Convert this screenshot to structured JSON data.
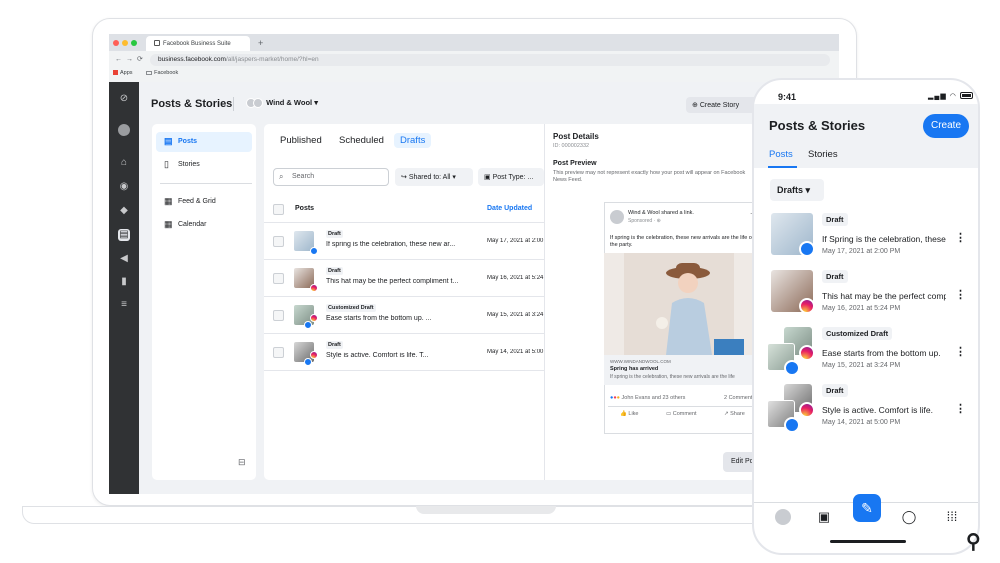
{
  "browser": {
    "tab_title": "Facebook Business Suite",
    "new_tab": "+",
    "url_host": "business.facebook.com",
    "url_path": "/all/jaspers-market/home/?hl=en",
    "bookmarks": [
      "Apps",
      "Facebook"
    ]
  },
  "desktop": {
    "page_title": "Posts & Stories",
    "account_name": "Wind & Wool",
    "create_story": "Create Story",
    "subnav": [
      {
        "label": "Posts",
        "icon": "posts-icon"
      },
      {
        "label": "Stories",
        "icon": "stories-icon"
      },
      {
        "label": "Feed & Grid",
        "icon": "feed-grid-icon"
      },
      {
        "label": "Calendar",
        "icon": "calendar-icon"
      }
    ],
    "tabs": [
      "Published",
      "Scheduled",
      "Drafts"
    ],
    "search_placeholder": "Search",
    "filter_shared": "Shared to: All",
    "filter_type": "Post Type: ...",
    "col_posts": "Posts",
    "col_date": "Date Updated",
    "rows": [
      {
        "tag": "Draft",
        "text": "If spring is the celebration, these new ar...",
        "date": "May 17, 2021 at 2:00 PM"
      },
      {
        "tag": "Draft",
        "text": "This hat may be the perfect compliment t...",
        "date": "May 16, 2021 at 5:24 PM"
      },
      {
        "tag": "Customized Draft",
        "text": "Ease starts from the bottom up. ...",
        "date": "May 15, 2021 at 3:24 PM"
      },
      {
        "tag": "Draft",
        "text": "Style is active. Comfort is life. T...",
        "date": "May 14, 2021 at 5:00 PM"
      }
    ],
    "details": {
      "title": "Post Details",
      "id": "ID: 000002332",
      "preview_title": "Post Preview",
      "preview_desc": "This preview may not represent exactly how your post will appear on Facebook News Feed.",
      "fb_page": "Wind & Wool shared a link.",
      "sponsored": "Sponsored · ⊕",
      "post_text": "If spring is the celebration, these new arrivals are the life of the party.",
      "link_domain": "WWW.WINDANDWOOL.COM",
      "link_title": "Spring has arrived",
      "link_sub": "If spring is the celebration, these new arrivals are the life",
      "reactions": "John Evans and 23 others",
      "comments": "2 Comments",
      "like": "Like",
      "comment": "Comment",
      "share": "Share",
      "edit": "Edit Post"
    }
  },
  "mobile": {
    "time": "9:41",
    "title": "Posts & Stories",
    "create": "Create",
    "tabs": [
      "Posts",
      "Stories"
    ],
    "filter": "Drafts",
    "rows": [
      {
        "tag": "Draft",
        "text": "If Spring is the celebration, these new arrivals",
        "date": "May 17, 2021 at 2:00 PM"
      },
      {
        "tag": "Draft",
        "text": "This hat may be the perfect compliment",
        "date": "May 16, 2021 at 5:24 PM"
      },
      {
        "tag": "Customized Draft",
        "text": "Ease starts from the bottom up.",
        "date": "May 15, 2021 at 3:24 PM"
      },
      {
        "tag": "Draft",
        "text": "Style is active. Comfort is life.",
        "date": "May 14, 2021 at 5:00 PM"
      }
    ]
  },
  "colors": {
    "accent": "#1877f2",
    "rail": "#303234",
    "instagram": "#e1306c"
  }
}
